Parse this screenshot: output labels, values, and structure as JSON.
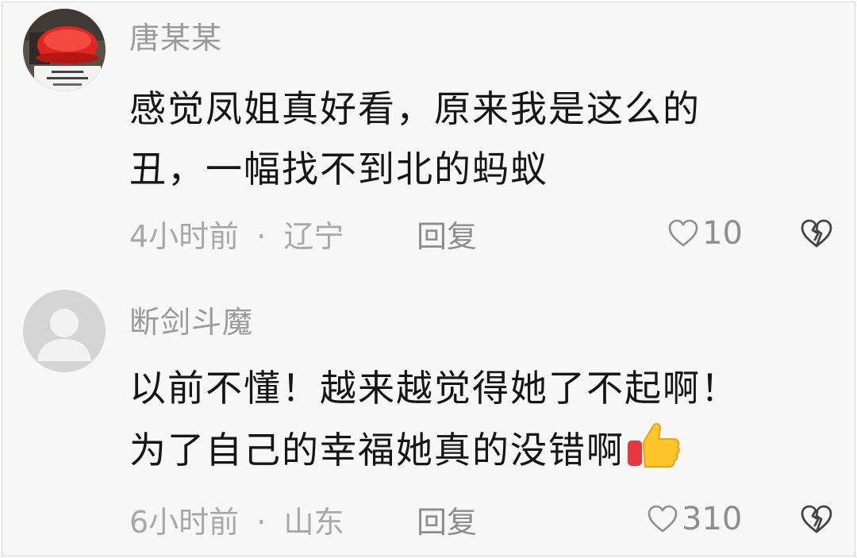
{
  "comments": [
    {
      "username": "唐某某",
      "lines": [
        "感觉凤姐真好看，原来我是这么的",
        "丑，一幅找不到北的蚂蚁"
      ],
      "time": "4小时前",
      "location": "辽宁",
      "reply_label": "回复",
      "likes": "10",
      "avatar_icon": "red-bowl-avatar-icon"
    },
    {
      "username": "断剑斗魔",
      "lines": [
        "以前不懂！越来越觉得她了不起啊！",
        "为了自己的幸福她真的没错啊"
      ],
      "time": "6小时前",
      "location": "山东",
      "reply_label": "回复",
      "likes": "310",
      "avatar_icon": "default-user-avatar-icon",
      "trailing_emoji": "thumbs-up-icon"
    }
  ],
  "separator": "·",
  "colors": {
    "background": "#f7f7f7",
    "username": "#9a9a9a",
    "body_text": "#161616",
    "meta_text": "#a8a8a8"
  }
}
